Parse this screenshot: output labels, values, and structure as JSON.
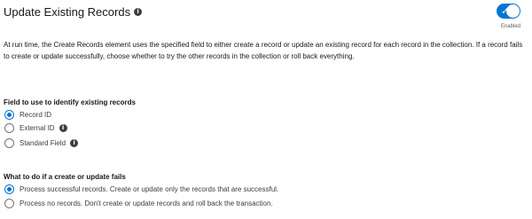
{
  "header": {
    "title": "Update Existing Records",
    "toggle_state": "Enabled"
  },
  "description": "At run time, the Create Records element uses the specified field to either create a record or update an existing record for each record in the collection. If a record fails to create or update successfully, choose whether to try the other records in the collection or roll back everything.",
  "identify_section": {
    "label": "Field to use to identify existing records",
    "options": [
      {
        "label": "Record ID",
        "selected": true,
        "has_info": false
      },
      {
        "label": "External ID",
        "selected": false,
        "has_info": true
      },
      {
        "label": "Standard Field",
        "selected": false,
        "has_info": true
      }
    ]
  },
  "failure_section": {
    "label": "What to do if a create or update fails",
    "options": [
      {
        "label": "Process successful records. Create or update only the records that are successful.",
        "selected": true
      },
      {
        "label": "Process no records. Don't create or update records and roll back the transaction.",
        "selected": false
      }
    ]
  },
  "colors": {
    "accent": "#0176d3",
    "text": "#181818"
  },
  "icons": {
    "info": "info-icon",
    "check": "check-icon"
  }
}
